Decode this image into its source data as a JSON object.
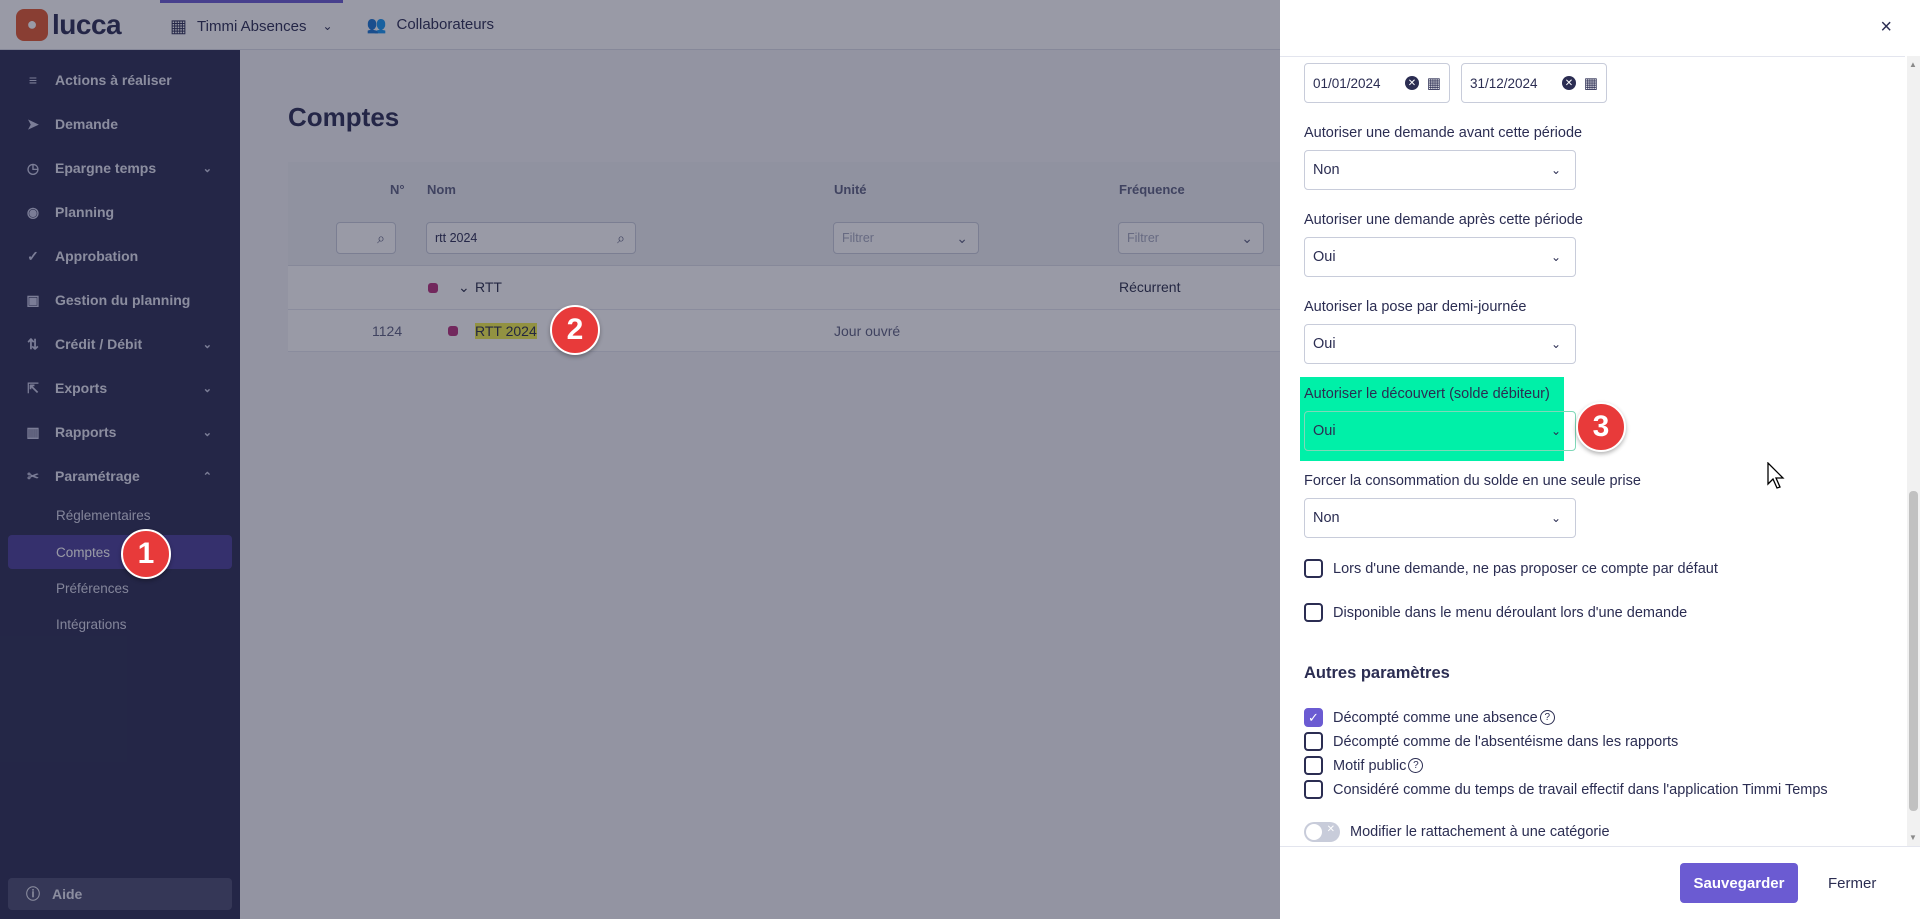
{
  "topbar": {
    "logo_mark": "●",
    "logo_text": "lucca",
    "app_name": "Timmi Absences",
    "nav": [
      {
        "label": "Collaborateurs"
      }
    ]
  },
  "sidebar": {
    "items": [
      {
        "label": "Actions à réaliser",
        "icon": "list-icon"
      },
      {
        "label": "Demande",
        "icon": "send-icon"
      },
      {
        "label": "Epargne temps",
        "icon": "clock-icon"
      },
      {
        "label": "Planning",
        "icon": "eye-icon"
      },
      {
        "label": "Approbation",
        "icon": "check-icon"
      },
      {
        "label": "Gestion du planning",
        "icon": "calendar-icon"
      },
      {
        "label": "Crédit / Débit",
        "icon": "arrows-icon"
      },
      {
        "label": "Exports",
        "icon": "export-icon"
      },
      {
        "label": "Rapports",
        "icon": "bar-chart-icon"
      },
      {
        "label": "Paramétrage",
        "icon": "tools-icon"
      }
    ],
    "sub_items": [
      {
        "label": "Réglementaires"
      },
      {
        "label": "Comptes"
      },
      {
        "label": "Préférences"
      },
      {
        "label": "Intégrations"
      }
    ],
    "help": "Aide"
  },
  "main": {
    "title": "Comptes",
    "columns": {
      "num": "N°",
      "name": "Nom",
      "unit": "Unité",
      "freq": "Fréquence"
    },
    "filters": {
      "name_value": "rtt 2024",
      "unit_placeholder": "Filtrer",
      "freq_placeholder": "Filtrer"
    },
    "group": {
      "name": "RTT",
      "frequency": "Récurrent"
    },
    "row": {
      "num": "1124",
      "name": "RTT 2024",
      "unit": "Jour ouvré"
    }
  },
  "panel": {
    "date_start": "01/01/2024",
    "date_end": "31/12/2024",
    "fields": [
      {
        "label": "Autoriser une demande avant cette période",
        "value": "Non"
      },
      {
        "label": "Autoriser une demande après cette période",
        "value": "Oui"
      },
      {
        "label": "Autoriser la pose par demi-journée",
        "value": "Oui"
      },
      {
        "label": "Autoriser le découvert (solde débiteur)",
        "value": "Oui"
      },
      {
        "label": "Forcer la consommation du solde en une seule prise",
        "value": "Non"
      }
    ],
    "checkboxes": [
      {
        "label": "Lors d'une demande, ne pas proposer ce compte par défaut",
        "checked": false
      },
      {
        "label": "Disponible dans le menu déroulant lors d'une demande",
        "checked": false
      }
    ],
    "other_title": "Autres paramètres",
    "other_checkboxes": [
      {
        "label": "Décompté comme une absence",
        "checked": true,
        "help": "?"
      },
      {
        "label": "Décompté comme de l'absentéisme dans les rapports",
        "checked": false
      },
      {
        "label": "Motif public",
        "checked": false,
        "help": "?"
      },
      {
        "label": "Considéré comme du temps de travail effectif dans l'application Timmi Temps",
        "checked": false
      }
    ],
    "toggle_label": "Modifier le rattachement à une catégorie",
    "save_label": "Sauvegarder",
    "close_label": "Fermer",
    "close_icon": "×"
  },
  "markers": [
    "1",
    "2",
    "3"
  ],
  "colors": {
    "primary": "#6b5bd2",
    "sidebar": "#2b2d52",
    "highlight_green": "#00f0a8",
    "marker_red": "#e83a3a"
  }
}
